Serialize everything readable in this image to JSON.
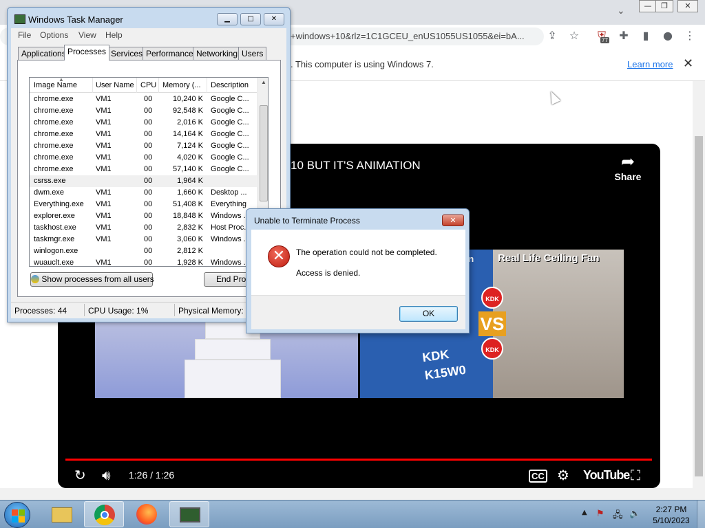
{
  "browser": {
    "url_fragment": "+windows+10&rlz=1C1GCEU_enUS1055US1055&ei=bA...",
    "extension_badge": "77",
    "infobar": {
      "text": ". This computer is using Windows 7.",
      "link": "Learn more",
      "close": "✕"
    },
    "controls": {
      "minimize": "—",
      "restore": "❐",
      "close": "✕",
      "tab_menu": "⌄"
    }
  },
  "video": {
    "title": "10 BUT IT'S ANIMATION",
    "share_label": "Share",
    "time": "1:26 / 1:26",
    "logo": "YouTube",
    "right_thumb_title": "Real Life Ceiling Fan",
    "right_thumb_left_title": "an",
    "kdk": "KDK",
    "vs": "VS",
    "kdk_model": "KDK\nK15W0",
    "progress": 1.0
  },
  "taskmanager": {
    "title": "Windows Task Manager",
    "menu": [
      "File",
      "Options",
      "View",
      "Help"
    ],
    "tabs": [
      "Applications",
      "Processes",
      "Services",
      "Performance",
      "Networking",
      "Users"
    ],
    "active_tab": "Processes",
    "columns": [
      "Image Name",
      "User Name",
      "CPU",
      "Memory (...",
      "Description"
    ],
    "rows": [
      {
        "name": "chrome.exe",
        "user": "VM1",
        "cpu": "00",
        "mem": "10,240 K",
        "desc": "Google C..."
      },
      {
        "name": "chrome.exe",
        "user": "VM1",
        "cpu": "00",
        "mem": "92,548 K",
        "desc": "Google C..."
      },
      {
        "name": "chrome.exe",
        "user": "VM1",
        "cpu": "00",
        "mem": "2,016 K",
        "desc": "Google C..."
      },
      {
        "name": "chrome.exe",
        "user": "VM1",
        "cpu": "00",
        "mem": "14,164 K",
        "desc": "Google C..."
      },
      {
        "name": "chrome.exe",
        "user": "VM1",
        "cpu": "00",
        "mem": "7,124 K",
        "desc": "Google C..."
      },
      {
        "name": "chrome.exe",
        "user": "VM1",
        "cpu": "00",
        "mem": "4,020 K",
        "desc": "Google C..."
      },
      {
        "name": "chrome.exe",
        "user": "VM1",
        "cpu": "00",
        "mem": "57,140 K",
        "desc": "Google C..."
      },
      {
        "name": "csrss.exe",
        "user": "",
        "cpu": "00",
        "mem": "1,964 K",
        "desc": ""
      },
      {
        "name": "dwm.exe",
        "user": "VM1",
        "cpu": "00",
        "mem": "1,660 K",
        "desc": "Desktop ..."
      },
      {
        "name": "Everything.exe",
        "user": "VM1",
        "cpu": "00",
        "mem": "51,408 K",
        "desc": "Everything"
      },
      {
        "name": "explorer.exe",
        "user": "VM1",
        "cpu": "00",
        "mem": "18,848 K",
        "desc": "Windows ..."
      },
      {
        "name": "taskhost.exe",
        "user": "VM1",
        "cpu": "00",
        "mem": "2,832 K",
        "desc": "Host Proc..."
      },
      {
        "name": "taskmgr.exe",
        "user": "VM1",
        "cpu": "00",
        "mem": "3,060 K",
        "desc": "Windows ..."
      },
      {
        "name": "winlogon.exe",
        "user": "",
        "cpu": "00",
        "mem": "2,812 K",
        "desc": ""
      },
      {
        "name": "wuauclt.exe",
        "user": "VM1",
        "cpu": "00",
        "mem": "1,928 K",
        "desc": "Windows ..."
      }
    ],
    "selected_row": 7,
    "show_all_button": "Show processes from all users",
    "end_process_button": "End Process",
    "status": {
      "processes": "Processes: 44",
      "cpu": "CPU Usage: 1%",
      "memory": "Physical Memory: 3"
    }
  },
  "dialog": {
    "title": "Unable to Terminate Process",
    "message": "The operation could not be completed.",
    "detail": "Access is denied.",
    "ok": "OK",
    "close_glyph": "✕",
    "error_glyph": "✕"
  },
  "taskbar": {
    "time": "2:27 PM",
    "date": "5/10/2023",
    "apps": [
      "explorer-icon",
      "chrome-icon",
      "firefox-icon",
      "taskmanager-icon"
    ]
  }
}
